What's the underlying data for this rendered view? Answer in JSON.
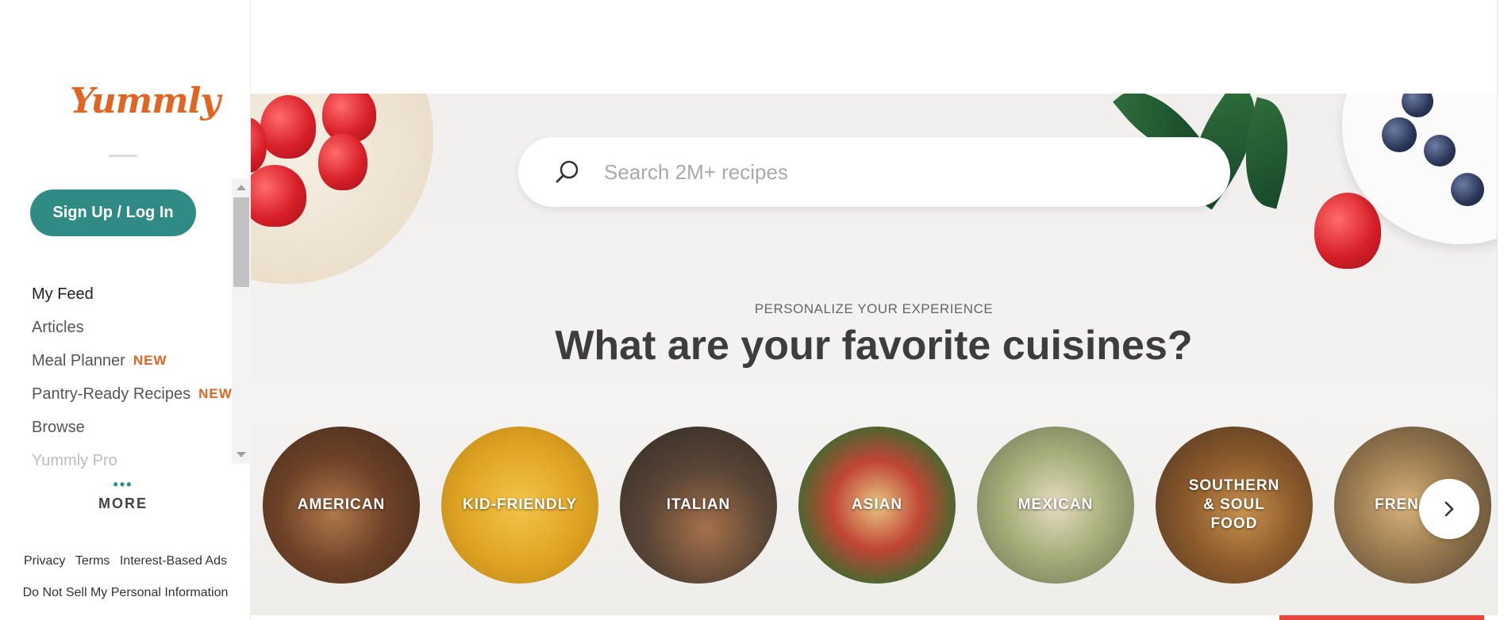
{
  "sidebar": {
    "logo_text": "Yummly",
    "signup_label": "Sign Up / Log In",
    "items": [
      {
        "label": "My Feed",
        "badge": ""
      },
      {
        "label": "Articles",
        "badge": ""
      },
      {
        "label": "Meal Planner",
        "badge": "NEW"
      },
      {
        "label": "Pantry-Ready Recipes",
        "badge": "NEW"
      },
      {
        "label": "Browse",
        "badge": ""
      },
      {
        "label": "Yummly Pro",
        "badge": ""
      }
    ],
    "more_dots": "•••",
    "more_label": "MORE",
    "footer": {
      "privacy": "Privacy",
      "terms": "Terms",
      "interest_ads": "Interest-Based Ads",
      "do_not_sell": "Do Not Sell My Personal Information"
    }
  },
  "search": {
    "placeholder": "Search 2M+ recipes",
    "value": ""
  },
  "hero": {
    "eyebrow": "PERSONALIZE YOUR EXPERIENCE",
    "headline": "What are your favorite cuisines?"
  },
  "cuisines": [
    {
      "label": "AMERICAN"
    },
    {
      "label": "KID-FRIENDLY"
    },
    {
      "label": "ITALIAN"
    },
    {
      "label": "ASIAN"
    },
    {
      "label": "MEXICAN"
    },
    {
      "label": "SOUTHERN & SOUL FOOD"
    },
    {
      "label": "FREN"
    }
  ],
  "icons": {
    "search": "search-icon",
    "next": "chevron-right-icon"
  },
  "colors": {
    "brand_orange": "#e06522",
    "signup_teal": "#2f8b83",
    "accent_red": "#e7453c"
  }
}
